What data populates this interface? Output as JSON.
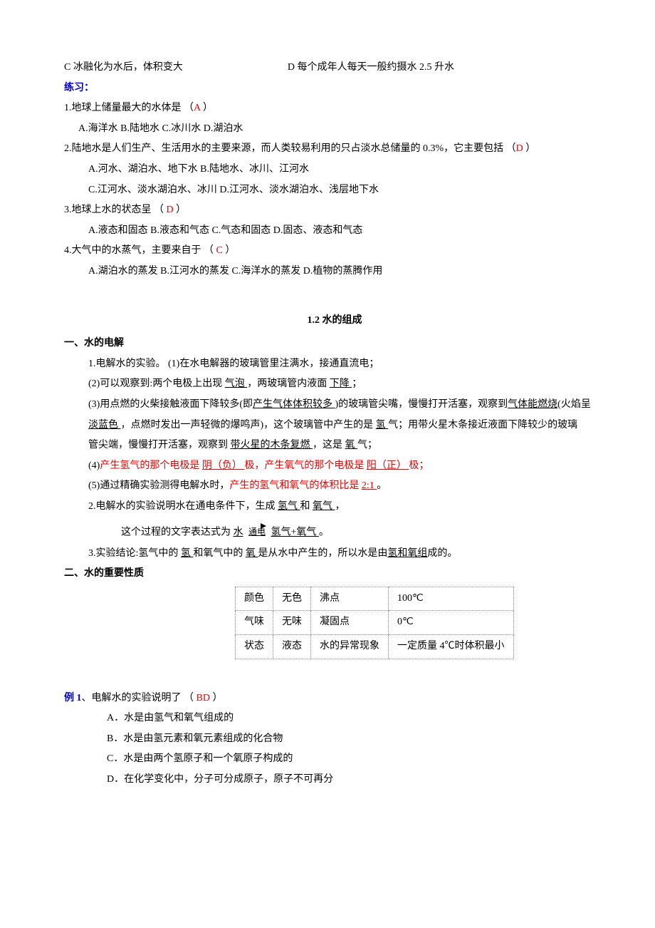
{
  "top": {
    "opt_c": "C 冰融化为水后，体积变大",
    "opt_d": "D 每个成年人每天一般约摄水 2.5 升水"
  },
  "practice_header": "练习：",
  "q1": {
    "stem_a": "1.地球上储量最大的水体是   （",
    "ans": "A",
    "stem_b": "  ）",
    "opts": "A.海洋水    B.陆地水    C.冰川水    D.湖泊水"
  },
  "q2": {
    "stem_a": " 2.陆地水是人们生产、生活用水的主要来源，而人类较易利用的只占淡水总储量的 0.3%，它主要包括 （",
    "ans": "D",
    "stem_b": " ）",
    "opts1": "A.河水、湖泊水、地下水       B.陆地水、冰川、江河水",
    "opts2": "C.江河水、淡水湖泊水、冰川    D.江河水、淡水湖泊水、浅层地下水"
  },
  "q3": {
    "stem_a": " 3.地球上水的状态呈    （  ",
    "ans": "D",
    "stem_b": "  ）",
    "opts": "A.液态和固态    B.液态和气态    C.气态和固态    D.固态、液态和气态"
  },
  "q4": {
    "stem_a": " 4.大气中的水蒸气，主要来自于  （  ",
    "ans": "C",
    "stem_b": " ）",
    "opts": "A.湖泊水的蒸发    B.江河水的蒸发    C.海洋水的蒸发    D.植物的蒸腾作用"
  },
  "section_title": "1.2  水的组成",
  "sec1_header": "一、水的电解",
  "sec1": {
    "p1": "1.电解水的实验。     (1)在水电解器的玻璃管里注满水，接通直流电；",
    "p2a": "(2)可以观察到:两个电极上出现  ",
    "p2u1": "气泡   ",
    "p2b": "，两玻璃管内液面  ",
    "p2u2": "下降   ",
    "p2c": "；",
    "p3a": "(3)用点燃的火柴接触液面下降较多(即",
    "p3u1": "产生气体体积较多   ",
    "p3b": ")的玻璃管尖嘴，慢慢打开活塞，观察到",
    "p3u2": "气体能燃烧",
    "p3c": "(火焰呈",
    "p3_line2a": "淡蓝色   ",
    "p3_line2b": "，点燃时发出一声轻微的爆鸣声)，这个玻璃管中产生的是  ",
    "p3_line2c": "氢   ",
    "p3_line2d": "气；用带火星木条接近液面下降较少的玻璃",
    "p3_line3a": "管尖端，慢慢打开活塞，观察到  ",
    "p3_line3b": "带火星的木条复燃   ",
    "p3_line3c": "，这是   ",
    "p3_line3d": "氧   ",
    "p3_line3e": "气；",
    "p4a": " (4)",
    "p4r1": "产生氢气的那个电极是   ",
    "p4u1": "阴（负）   ",
    "p4r2": "极，产生氧气的那个电极是   ",
    "p4u2": "阳（正）   ",
    "p4r3": "极；",
    "p5a": " (5)通过精确实验测得电解水时，",
    "p5r": "产生的氢气和氧气的体积比是   ",
    "p5u": "2:1   ",
    "p5b": "。",
    "p6a": " 2.电解水的实验说明水在通电条件下，生成  ",
    "p6u1": "氢气   ",
    "p6b": "和  ",
    "p6u2": "氧气   ",
    "p6c": "，",
    "expr_a": "这个过程的文字表达式为 ",
    "expr_w": "水",
    "expr_cond": "通电",
    "expr_b": "  氢气+氧气   ",
    "expr_c": "。",
    "p7a": "3.实验结论:氢气中的  ",
    "p7u1": "氢 ",
    "p7b": "和氧气中的  ",
    "p7u2": "氧 ",
    "p7c": "是从水中产生的，所以水是由",
    "p7u3": "氢和氧组",
    "p7d": "成的。"
  },
  "sec2_header": "二、水的重要性质",
  "table": {
    "r1c1": "颜色",
    "r1c2": "无色",
    "r1c3": "沸点",
    "r1c4": "100℃",
    "r2c1": "气味",
    "r2c2": "无味",
    "r2c3": "凝固点",
    "r2c4": "0℃",
    "r3c1": "状态",
    "r3c2": "液态",
    "r3c3": "水的异常现象",
    "r3c4": "一定质量 4℃时体积最小"
  },
  "ex1": {
    "label": "例 1",
    "stem_a": "、电解水的实验说明了        （  ",
    "ans": "BD",
    "stem_b": "  ）",
    "optA": "A．水是由氢气和氧气组成的",
    "optB": "B．水是由氢元素和氧元素组成的化合物",
    "optC": "C．水是由两个氢原子和一个氧原子构成的",
    "optD": "D．在化学变化中，分子可分成原子，原子不可再分"
  }
}
